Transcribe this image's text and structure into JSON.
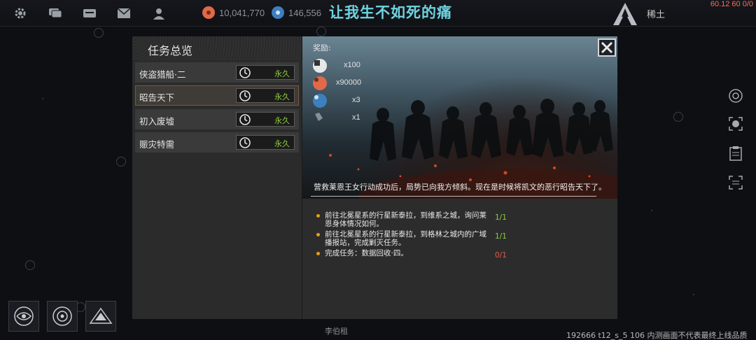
{
  "topbar": {
    "resource_1": "10,041,770",
    "resource_2": "146,556",
    "title": "让我生不如死的痛",
    "rank": "稀土",
    "fps": "60.12 60 0/0"
  },
  "quest_panel": {
    "header": "任务总览",
    "quests": [
      {
        "name": "侠盗猎船·二",
        "duration": "永久"
      },
      {
        "name": "昭告天下",
        "duration": "永久"
      },
      {
        "name": "初入废墟",
        "duration": "永久"
      },
      {
        "name": "赈灾特需",
        "duration": "永久"
      }
    ]
  },
  "detail": {
    "reward_label": "奖励:",
    "rewards": [
      {
        "icon": "credits-icon",
        "qty": "x100"
      },
      {
        "icon": "coin-icon",
        "qty": "x90000"
      },
      {
        "icon": "crystal-icon",
        "qty": "x3"
      },
      {
        "icon": "item-icon",
        "qty": "x1"
      }
    ],
    "description": "营救莱恩王女行动成功后，局势已向我方倾斜。现在是时候将凯文的恶行昭告天下了。",
    "objectives": [
      {
        "text": "前往北冕星系的行星新泰拉，到维系之城，询问莱恩身体情况如何。",
        "progress": "1/1",
        "done": true
      },
      {
        "text": "前往北冕星系的行星新泰拉，到格林之城内的广域播报站，完成剿灭任务。",
        "progress": "1/1",
        "done": true
      },
      {
        "text": "完成任务：数据回收·四。",
        "progress": "0/1",
        "done": false
      }
    ]
  },
  "bottom": {
    "name": "李伯租",
    "build_info": "192666 t12_s_5 106 内测画面不代表最终上线品质"
  },
  "colors": {
    "accent": "#6fd3e0",
    "done": "#8fcf3f",
    "todo": "#e05a4a",
    "bullet": "#e4a018"
  }
}
